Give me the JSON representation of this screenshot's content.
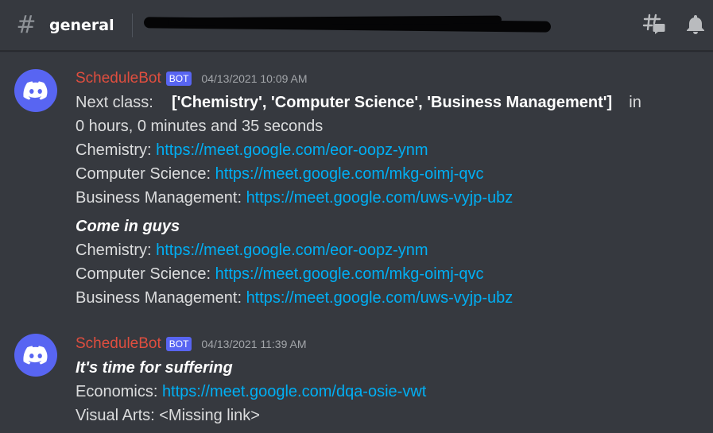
{
  "header": {
    "channel_name": "general",
    "icons": [
      "hash-icon",
      "threads-icon",
      "bell-icon"
    ]
  },
  "messages": [
    {
      "username": "ScheduleBot",
      "bot_tag": "BOT",
      "timestamp": "04/13/2021 10:09 AM",
      "next_class_label": "Next class:",
      "next_class_value": "['Chemistry', 'Computer Science', 'Business Management']",
      "in_word": "in",
      "countdown": "0 hours, 0 minutes and 35 seconds",
      "links1": [
        {
          "label": "Chemistry: ",
          "url": "https://meet.google.com/eor-oopz-ynm"
        },
        {
          "label": "Computer Science: ",
          "url": "https://meet.google.com/mkg-oimj-qvc"
        },
        {
          "label": "Business Management: ",
          "url": "https://meet.google.com/uws-vyjp-ubz"
        }
      ],
      "emphasis": "Come in guys",
      "links2": [
        {
          "label": "Chemistry: ",
          "url": "https://meet.google.com/eor-oopz-ynm"
        },
        {
          "label": "Computer Science: ",
          "url": "https://meet.google.com/mkg-oimj-qvc"
        },
        {
          "label": "Business Management: ",
          "url": "https://meet.google.com/uws-vyjp-ubz"
        }
      ]
    },
    {
      "username": "ScheduleBot",
      "bot_tag": "BOT",
      "timestamp": "04/13/2021 11:39 AM",
      "emphasis": "It's time for suffering",
      "links": [
        {
          "label": "Economics: ",
          "url": "https://meet.google.com/dqa-osie-vwt"
        }
      ],
      "missing_line": "Visual Arts: <Missing link>"
    }
  ],
  "colors": {
    "background": "#36393f",
    "username": "#e04e3f",
    "bot_tag": "#5865f2",
    "link": "#00aff4",
    "text": "#dcddde"
  }
}
